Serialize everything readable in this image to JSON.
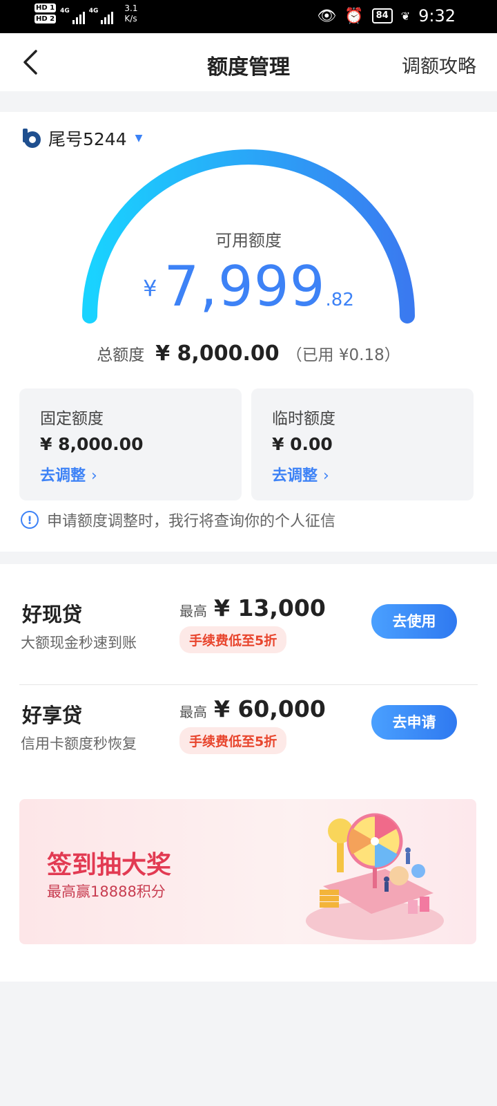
{
  "status_bar": {
    "hd1": "HD 1",
    "hd2": "HD 2",
    "net1": "4G",
    "net2": "4G",
    "speed_value": "3.1",
    "speed_unit": "K/s",
    "battery": "84",
    "time": "9:32"
  },
  "header": {
    "back_icon": "chevron-left-icon",
    "title": "额度管理",
    "action": "调额攻略"
  },
  "quota": {
    "card_tail": "尾号5244",
    "available_label": "可用额度",
    "currency": "¥",
    "available_int": "7,999",
    "available_dec": ".82",
    "gauge_fraction": 0.99998,
    "total_label": "总额度",
    "total_value": "¥ 8,000.00",
    "used_text": "（已用 ¥0.18）",
    "fixed": {
      "title": "固定额度",
      "value": "¥ 8,000.00",
      "link": "去调整"
    },
    "temporary": {
      "title": "临时额度",
      "value": "¥ 0.00",
      "link": "去调整"
    },
    "notice": "申请额度调整时，我行将查询你的个人征信",
    "gauge_colors": [
      "#19d3ff",
      "#3a7af0"
    ]
  },
  "loans": [
    {
      "name": "好现贷",
      "desc": "大额现金秒速到账",
      "max_label": "最高",
      "max_amount": "¥ 13,000",
      "fee_tag": "手续费低至5折",
      "button": "去使用"
    },
    {
      "name": "好享贷",
      "desc": "信用卡额度秒恢复",
      "max_label": "最高",
      "max_amount": "¥ 60,000",
      "fee_tag": "手续费低至5折",
      "button": "去申请"
    }
  ],
  "banner": {
    "title": "签到抽大奖",
    "subtitle": "最高赢18888积分",
    "illustration": "prize-wheel-illustration"
  },
  "colors": {
    "accent": "#3d82f6",
    "fee_red": "#e8452d",
    "banner_red": "#e23a52"
  }
}
